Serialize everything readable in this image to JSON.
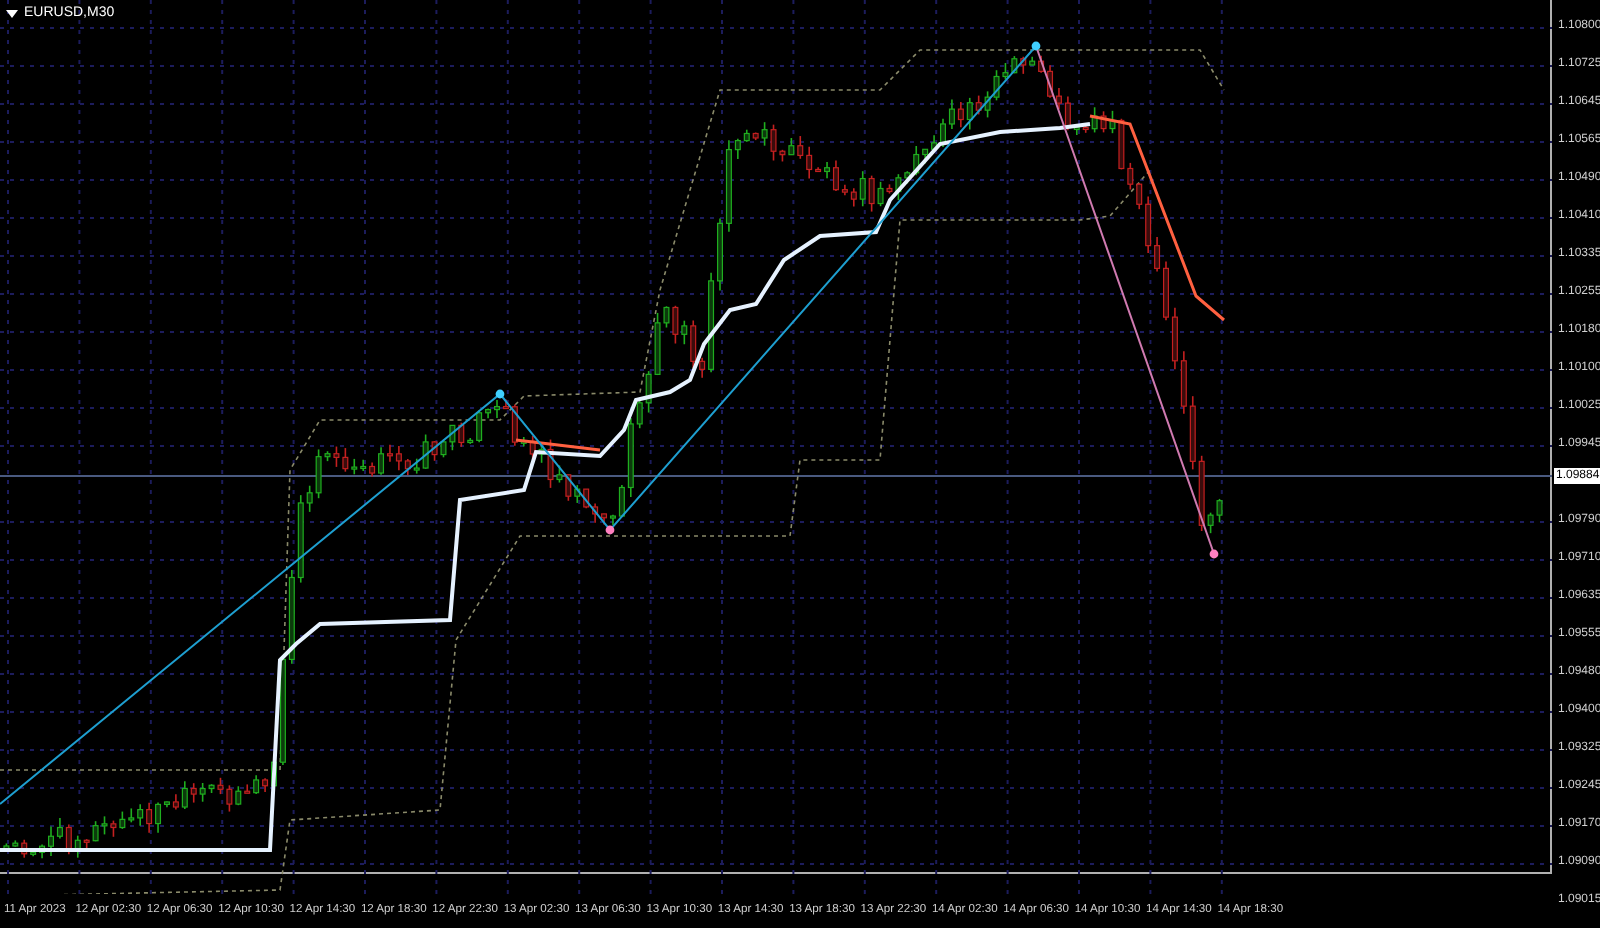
{
  "chart": {
    "title": "EURUSD,M30"
  },
  "price_axis": [
    "1.10800",
    "1.10725",
    "1.10645",
    "1.10565",
    "1.10490",
    "1.10410",
    "1.10335",
    "1.10255",
    "1.10180",
    "1.10100",
    "1.10025",
    "1.09945",
    "1.09790",
    "1.09710",
    "1.09635",
    "1.09555",
    "1.09480",
    "1.09400",
    "1.09325",
    "1.09245",
    "1.09170",
    "1.09090",
    "1.09015"
  ],
  "current_price": "1.09884",
  "time_axis": [
    "11 Apr 2023",
    "12 Apr 02:30",
    "12 Apr 06:30",
    "12 Apr 10:30",
    "12 Apr 14:30",
    "12 Apr 18:30",
    "12 Apr 22:30",
    "13 Apr 02:30",
    "13 Apr 06:30",
    "13 Apr 10:30",
    "13 Apr 14:30",
    "13 Apr 18:30",
    "13 Apr 22:30",
    "14 Apr 02:30",
    "14 Apr 06:30",
    "14 Apr 10:30",
    "14 Apr 14:30",
    "14 Apr 18:30"
  ]
}
